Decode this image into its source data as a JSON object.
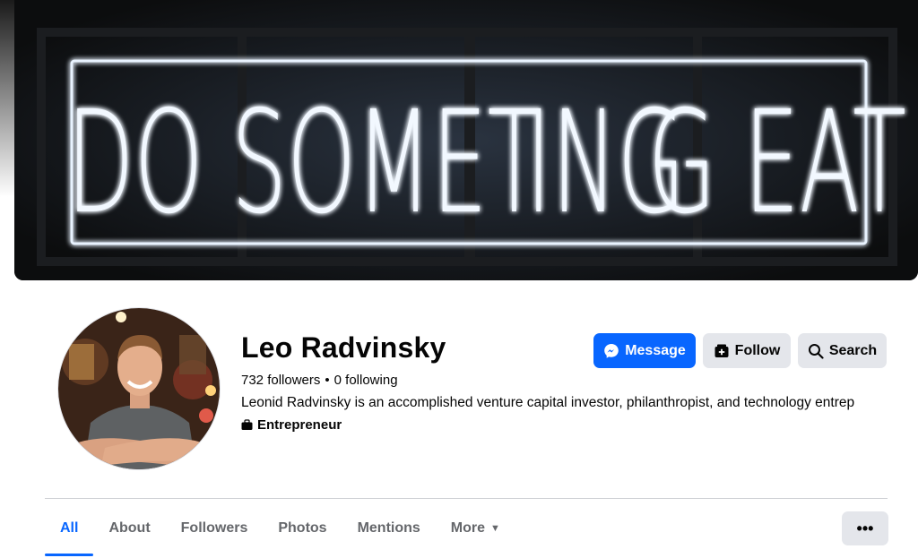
{
  "cover": {
    "neon_text_left": "DO SOMET",
    "neon_text_middle": "ING",
    "neon_text_right": "G EAT"
  },
  "profile": {
    "name": "Leo Radvinsky",
    "followers": "732 followers",
    "separator": "•",
    "following": "0 following",
    "bio": "Leonid Radvinsky is an accomplished venture capital investor, philanthropist, and technology entrep",
    "work_label": "Entrepreneur"
  },
  "actions": {
    "message_label": "Message",
    "follow_label": "Follow",
    "search_label": "Search"
  },
  "tabs": [
    {
      "label": "All"
    },
    {
      "label": "About"
    },
    {
      "label": "Followers"
    },
    {
      "label": "Photos"
    },
    {
      "label": "Mentions"
    },
    {
      "label": "More"
    }
  ],
  "more_options_label": "•••",
  "colors": {
    "accent": "#0866ff",
    "button_gray": "#e4e6eb",
    "text_secondary": "#65676b"
  },
  "icons": {
    "message": "messenger-icon",
    "follow": "follow-icon",
    "search": "search-icon",
    "work": "briefcase-icon",
    "more_caret": "caret-down-icon"
  }
}
